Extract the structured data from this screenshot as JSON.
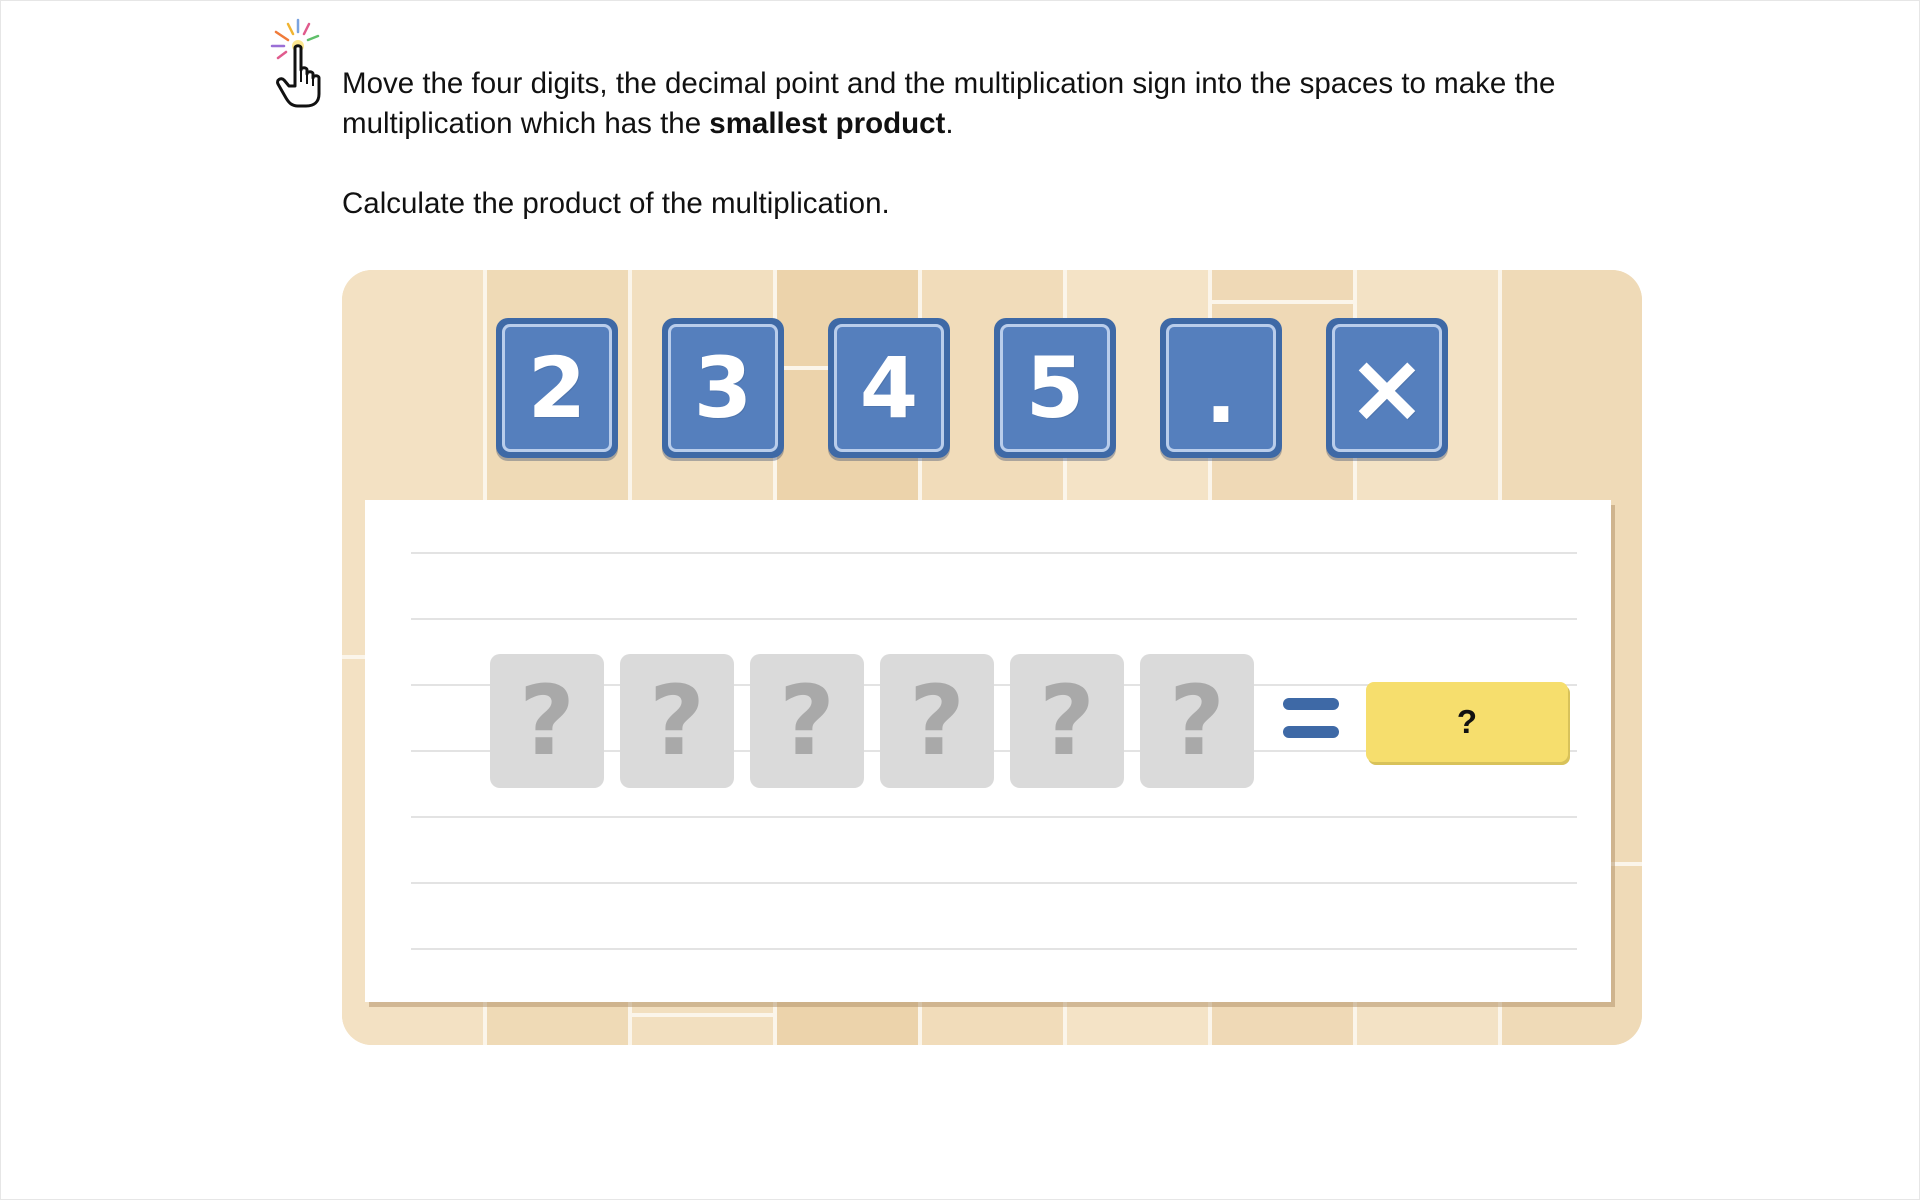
{
  "instructions": {
    "line1_prefix": "Move the four digits, the decimal point and the multiplication sign into the spaces to make the multiplication which has the ",
    "line1_bold": "smallest product",
    "line1_suffix": ".",
    "line2": "Calculate the product of the multiplication."
  },
  "tiles": [
    {
      "label": "2"
    },
    {
      "label": "3"
    },
    {
      "label": "4"
    },
    {
      "label": "5"
    },
    {
      "label": "."
    },
    {
      "label": "×"
    }
  ],
  "slots": [
    {
      "label": "?"
    },
    {
      "label": "?"
    },
    {
      "label": "?"
    },
    {
      "label": "?"
    },
    {
      "label": "?"
    },
    {
      "label": "?"
    }
  ],
  "answer": {
    "label": "?"
  },
  "colors": {
    "tile_blue": "#3e69a6",
    "answer_yellow": "#f6de6d",
    "wood": "#f1dfbf"
  },
  "icons": {
    "pointer": "hand-pointer-icon",
    "equals": "equals-icon"
  }
}
